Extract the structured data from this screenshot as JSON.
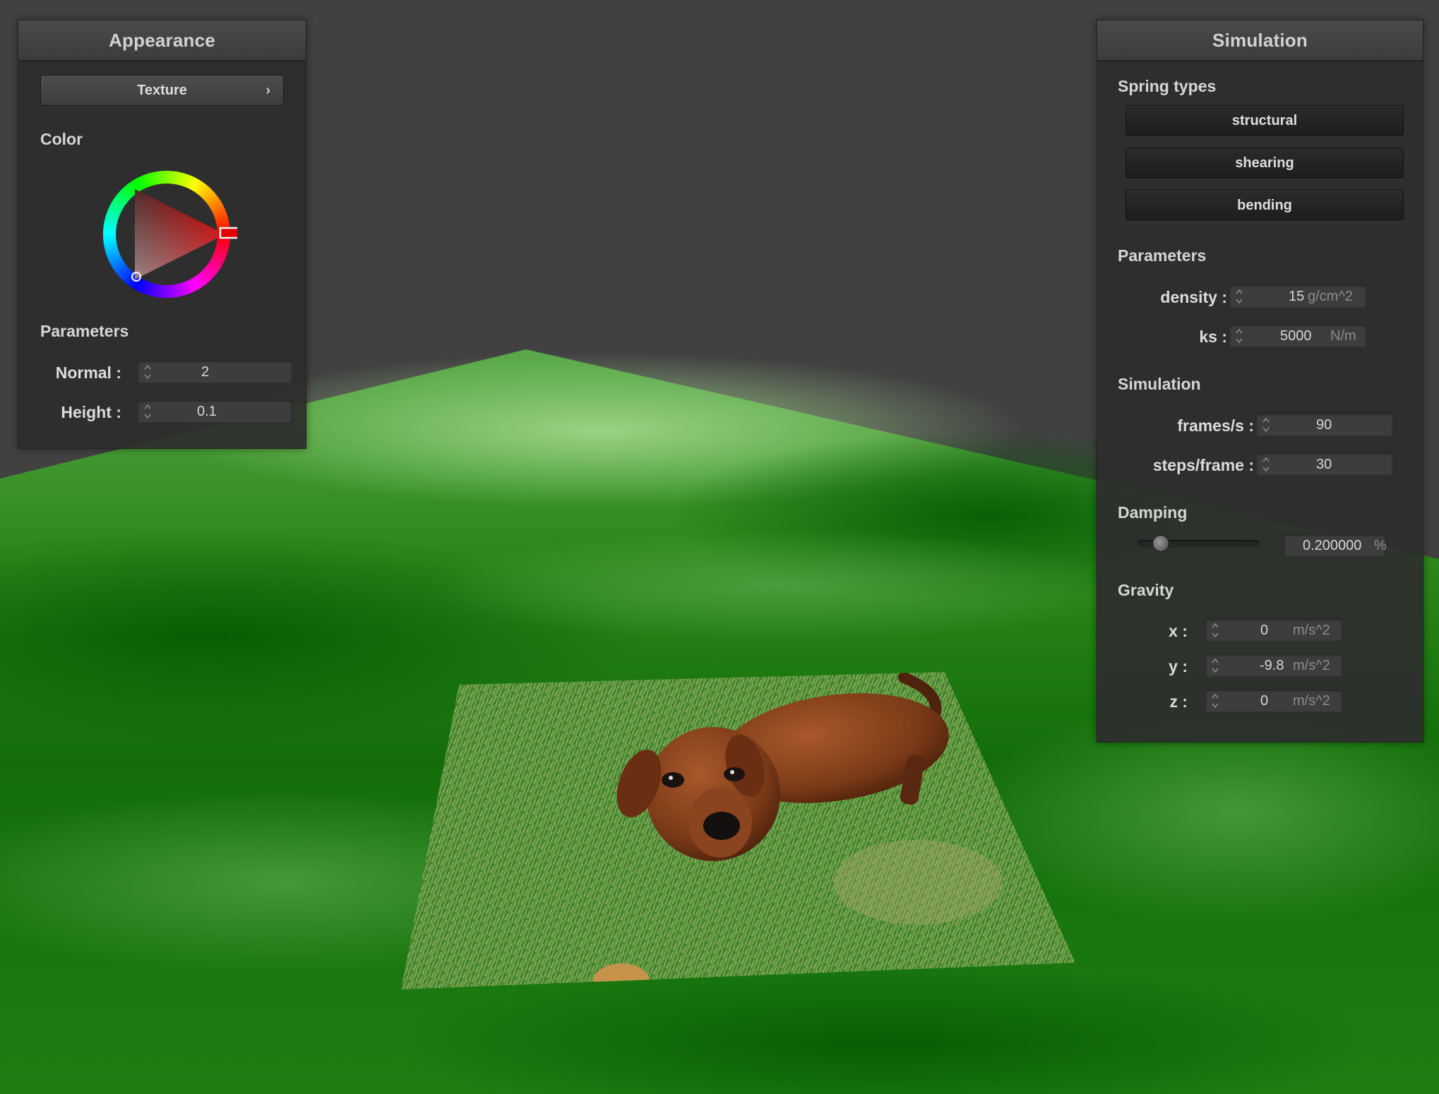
{
  "scene": {
    "floor_color": "#1e7d10",
    "background_color": "#414141",
    "cloth_texture": "dachshund-on-grass-photo"
  },
  "appearance": {
    "title": "Appearance",
    "texture_button": "Texture",
    "texture_chevron": "›",
    "color_label": "Color",
    "selected_color": "#e00000",
    "parameters_label": "Parameters",
    "normal_label": "Normal :",
    "normal_value": "2",
    "height_label": "Height :",
    "height_value": "0.1"
  },
  "simulation": {
    "title": "Simulation",
    "spring_types_label": "Spring types",
    "spring_types": [
      "structural",
      "shearing",
      "bending"
    ],
    "parameters_label": "Parameters",
    "density_label": "density :",
    "density_value": "15",
    "density_unit": "g/cm^2",
    "ks_label": "ks :",
    "ks_value": "5000",
    "ks_unit": "N/m",
    "simulation_label": "Simulation",
    "fps_label": "frames/s :",
    "fps_value": "90",
    "steps_label": "steps/frame :",
    "steps_value": "30",
    "damping_label": "Damping",
    "damping_value": "0.200000",
    "damping_unit": "%",
    "damping_fraction": 0.2,
    "gravity_label": "Gravity",
    "gx_label": "x :",
    "gx_value": "0",
    "gy_label": "y :",
    "gy_value": "-9.8",
    "gz_label": "z :",
    "gz_value": "0",
    "gravity_unit": "m/s^2"
  }
}
